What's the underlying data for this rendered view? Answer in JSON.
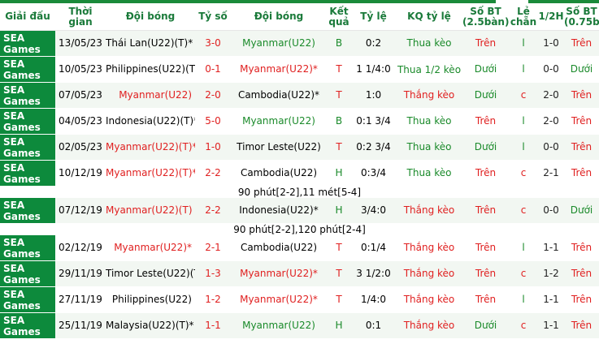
{
  "headers": {
    "league": "Giải đấu",
    "time": "Thời gian",
    "home": "Đội bóng",
    "score": "Tỷ số",
    "away": "Đội bóng",
    "result": "Kết quả",
    "odds": "Tỷ lệ",
    "odds_result": "KQ tỷ lệ",
    "bt25": "Số BT (2.5bàn)",
    "oddeven": "Lẻ chẵn",
    "half": "1/2H",
    "bt075": "Số BT (0.75bàn)"
  },
  "rows": [
    {
      "league": "SEA Games",
      "date": "13/05/23",
      "home": "Thái Lan(U22)(T)*",
      "score": "3-0",
      "away": "Myanmar(U22)",
      "result": "B",
      "odds": "0:2",
      "odds_result": "Thua kèo",
      "bt25": "Trên",
      "oddeven": "l",
      "half": "1-0",
      "bt075": "Trên"
    },
    {
      "league": "SEA Games",
      "date": "10/05/23",
      "home": "Philippines(U22)(T)",
      "score": "0-1",
      "away": "Myanmar(U22)*",
      "result": "T",
      "odds": "1 1/4:0",
      "odds_result": "Thua 1/2 kèo",
      "bt25": "Dưới",
      "oddeven": "l",
      "half": "0-0",
      "bt075": "Dưới"
    },
    {
      "league": "SEA Games",
      "date": "07/05/23",
      "home": "Myanmar(U22)",
      "score": "2-0",
      "away": "Cambodia(U22)*",
      "result": "T",
      "odds": "1:0",
      "odds_result": "Thắng kèo",
      "bt25": "Dưới",
      "oddeven": "c",
      "half": "2-0",
      "bt075": "Trên"
    },
    {
      "league": "SEA Games",
      "date": "04/05/23",
      "home": "Indonesia(U22)(T)*",
      "score": "5-0",
      "away": "Myanmar(U22)",
      "result": "B",
      "odds": "0:1 3/4",
      "odds_result": "Thua kèo",
      "bt25": "Trên",
      "oddeven": "l",
      "half": "2-0",
      "bt075": "Trên"
    },
    {
      "league": "SEA Games",
      "date": "02/05/23",
      "home": "Myanmar(U22)(T)*",
      "score": "1-0",
      "away": "Timor Leste(U22)",
      "result": "T",
      "odds": "0:2 3/4",
      "odds_result": "Thua kèo",
      "bt25": "Dưới",
      "oddeven": "l",
      "half": "0-0",
      "bt075": "Trên"
    },
    {
      "league": "SEA Games",
      "date": "10/12/19",
      "home": "Myanmar(U22)(T)*",
      "score": "2-2",
      "away": "Cambodia(U22)",
      "result": "H",
      "odds": "0:3/4",
      "odds_result": "Thua kèo",
      "bt25": "Trên",
      "oddeven": "c",
      "half": "2-1",
      "bt075": "Trên"
    },
    {
      "league": "SEA Games",
      "date": "07/12/19",
      "home": "Myanmar(U22)(T)",
      "score": "2-2",
      "away": "Indonesia(U22)*",
      "result": "H",
      "odds": "3/4:0",
      "odds_result": "Thắng kèo",
      "bt25": "Trên",
      "oddeven": "c",
      "half": "0-0",
      "bt075": "Dưới"
    },
    {
      "league": "SEA Games",
      "date": "02/12/19",
      "home": "Myanmar(U22)*",
      "score": "2-1",
      "away": "Cambodia(U22)",
      "result": "T",
      "odds": "0:1/4",
      "odds_result": "Thắng kèo",
      "bt25": "Trên",
      "oddeven": "l",
      "half": "1-1",
      "bt075": "Trên"
    },
    {
      "league": "SEA Games",
      "date": "29/11/19",
      "home": "Timor Leste(U22)(T)",
      "score": "1-3",
      "away": "Myanmar(U22)*",
      "result": "T",
      "odds": "3 1/2:0",
      "odds_result": "Thắng kèo",
      "bt25": "Trên",
      "oddeven": "c",
      "half": "1-2",
      "bt075": "Trên"
    },
    {
      "league": "SEA Games",
      "date": "27/11/19",
      "home": "Philippines(U22)",
      "score": "1-2",
      "away": "Myanmar(U22)*",
      "result": "T",
      "odds": "1/4:0",
      "odds_result": "Thắng kèo",
      "bt25": "Trên",
      "oddeven": "l",
      "half": "1-1",
      "bt075": "Trên"
    },
    {
      "league": "SEA Games",
      "date": "25/11/19",
      "home": "Malaysia(U22)(T)*",
      "score": "1-1",
      "away": "Myanmar(U22)",
      "result": "H",
      "odds": "0:1",
      "odds_result": "Thắng kèo",
      "bt25": "Dưới",
      "oddeven": "c",
      "half": "1-1",
      "bt075": "Trên"
    }
  ],
  "notes": {
    "after_row_6": "90 phút[2-2],11 mét[5-4]",
    "after_row_7": "90 phút[2-2],120 phút[2-4]"
  },
  "colors": {
    "league_bg": "#0d8a3c",
    "header_text": "#1a7a3a",
    "myanmar_red": "#e02020",
    "away_green": "#1a8a2a"
  }
}
